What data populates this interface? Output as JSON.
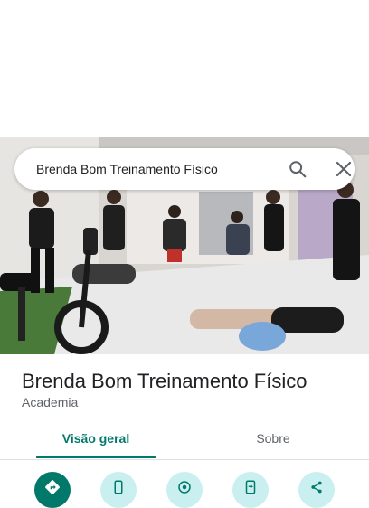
{
  "search": {
    "query": "Brenda Bom Treinamento Físico"
  },
  "place": {
    "name": "Brenda Bom Treinamento Físico",
    "category": "Academia"
  },
  "tabs": [
    {
      "label": "Visão geral",
      "active": true
    },
    {
      "label": "Sobre",
      "active": false
    }
  ],
  "actions": [
    {
      "icon": "directions-icon",
      "primary": true
    },
    {
      "icon": "phone-icon",
      "primary": false
    },
    {
      "icon": "nearby-icon",
      "primary": false
    },
    {
      "icon": "send-to-phone-icon",
      "primary": false
    },
    {
      "icon": "share-icon",
      "primary": false
    }
  ],
  "colors": {
    "accent": "#00796b",
    "action_bg": "#c9eff0",
    "title": "#202124",
    "secondary": "#5f6368"
  }
}
